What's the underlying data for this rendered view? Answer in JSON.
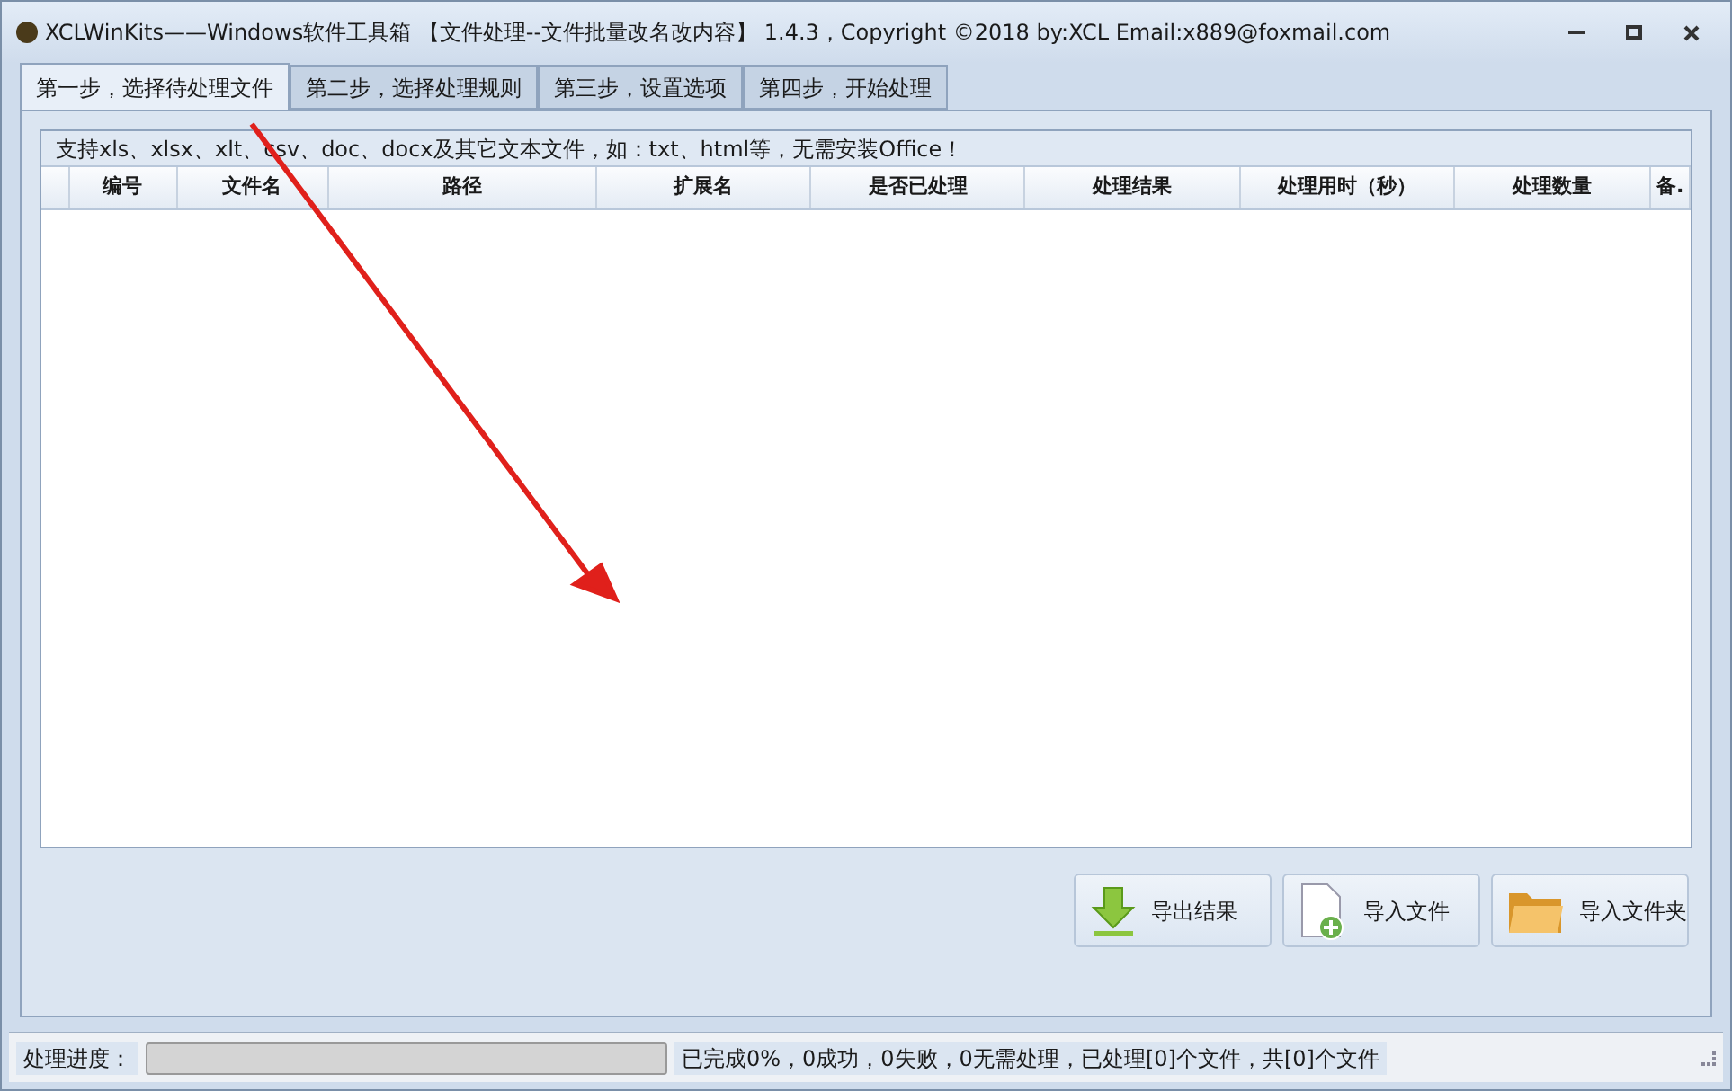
{
  "window": {
    "title": "XCLWinKits——Windows软件工具箱 【文件处理--文件批量改名改内容】 1.4.3，Copyright ©2018 by:XCL Email:x889@foxmail.com"
  },
  "tabs": [
    {
      "label": "第一步，选择待处理文件",
      "selected": true
    },
    {
      "label": "第二步，选择处理规则",
      "selected": false
    },
    {
      "label": "第三步，设置选项",
      "selected": false
    },
    {
      "label": "第四步，开始处理",
      "selected": false
    }
  ],
  "hint": "支持xls、xlsx、xlt、csv、doc、docx及其它文本文件，如：txt、html等，无需安装Office！",
  "table": {
    "columns": [
      "编号",
      "文件名",
      "路径",
      "扩展名",
      "是否已处理",
      "处理结果",
      "处理用时（秒）",
      "处理数量",
      "备."
    ]
  },
  "buttons": [
    {
      "label": "导出结果",
      "kind": "export"
    },
    {
      "label": "导入文件",
      "kind": "file"
    },
    {
      "label": "导入文件夹",
      "kind": "folder"
    }
  ],
  "status_bar": {
    "label": "处理进度：",
    "progress": {
      "level": 0
    },
    "summary": "已完成0%，0成功，0失败，0无需处理，已处理[0]个文件，共[0]个文件"
  }
}
